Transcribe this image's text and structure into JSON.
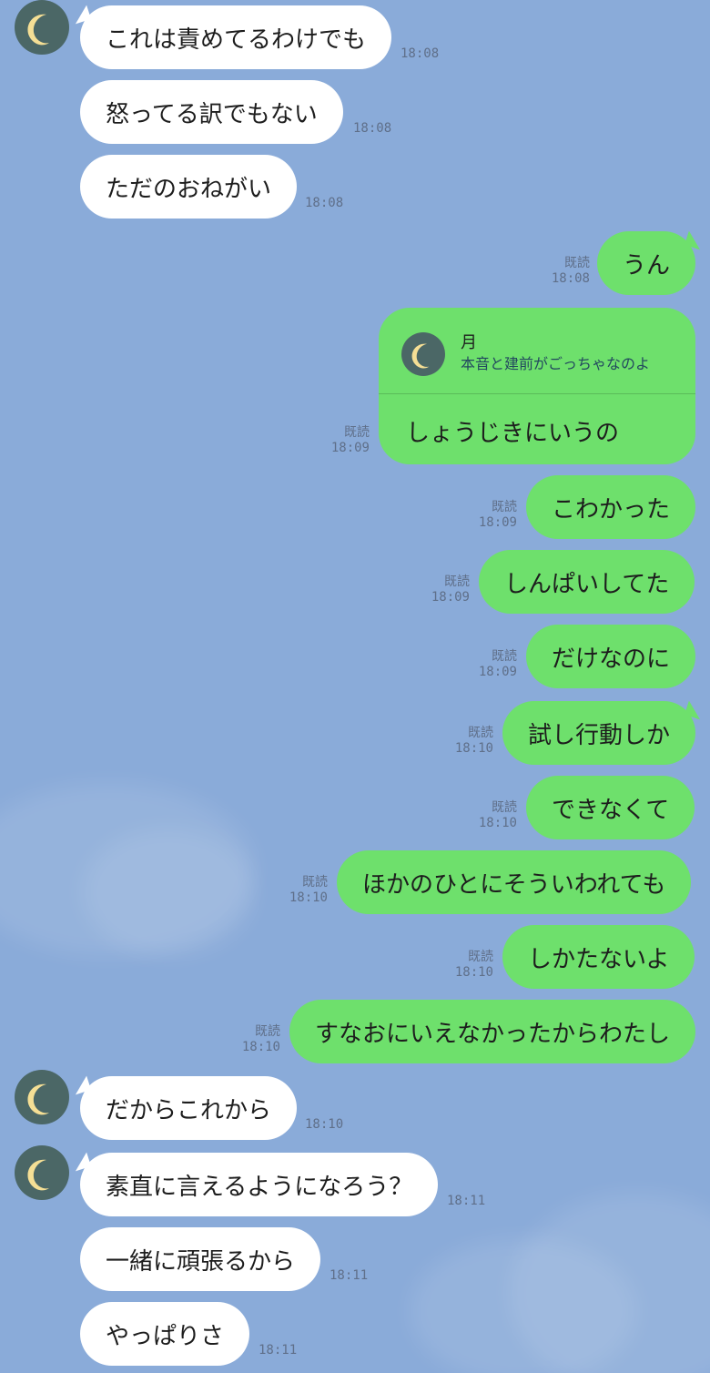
{
  "chat": {
    "contact_name": "月",
    "read_label": "既読",
    "avatar_icon": "crescent-moon-icon",
    "messages": {
      "m1": {
        "text": "これは責めてるわけでも",
        "time": "18:08"
      },
      "m2": {
        "text": "怒ってる訳でもない",
        "time": "18:08"
      },
      "m3": {
        "text": "ただのおねがい",
        "time": "18:08"
      },
      "m4": {
        "text": "うん",
        "time": "18:08"
      },
      "m5": {
        "quoted_name": "月",
        "quoted_text": "本音と建前がごっちゃなのよ",
        "text": "しょうじきにいうの",
        "time": "18:09"
      },
      "m6": {
        "text": "こわかった",
        "time": "18:09"
      },
      "m7": {
        "text": "しんぱいしてた",
        "time": "18:09"
      },
      "m8": {
        "text": "だけなのに",
        "time": "18:09"
      },
      "m9": {
        "text": "試し行動しか",
        "time": "18:10"
      },
      "m10": {
        "text": "できなくて",
        "time": "18:10"
      },
      "m11": {
        "text": "ほかのひとにそういわれても",
        "time": "18:10"
      },
      "m12": {
        "text": "しかたないよ",
        "time": "18:10"
      },
      "m13": {
        "text": "すなおにいえなかったからわたし",
        "time": "18:10"
      },
      "m14": {
        "text": "だからこれから",
        "time": "18:10"
      },
      "m15": {
        "text": "素直に言えるようになろう？",
        "time": "18:11"
      },
      "m16": {
        "text": "一緒に頑張るから",
        "time": "18:11"
      },
      "m17": {
        "text": "やっぱりさ",
        "time": "18:11"
      }
    }
  },
  "colors": {
    "background": "#8aabd9",
    "incoming_bubble": "#ffffff",
    "outgoing_bubble": "#6ee06c",
    "avatar": "#4b6766",
    "moon": "#f5df95",
    "meta_text": "#5f6f89"
  }
}
